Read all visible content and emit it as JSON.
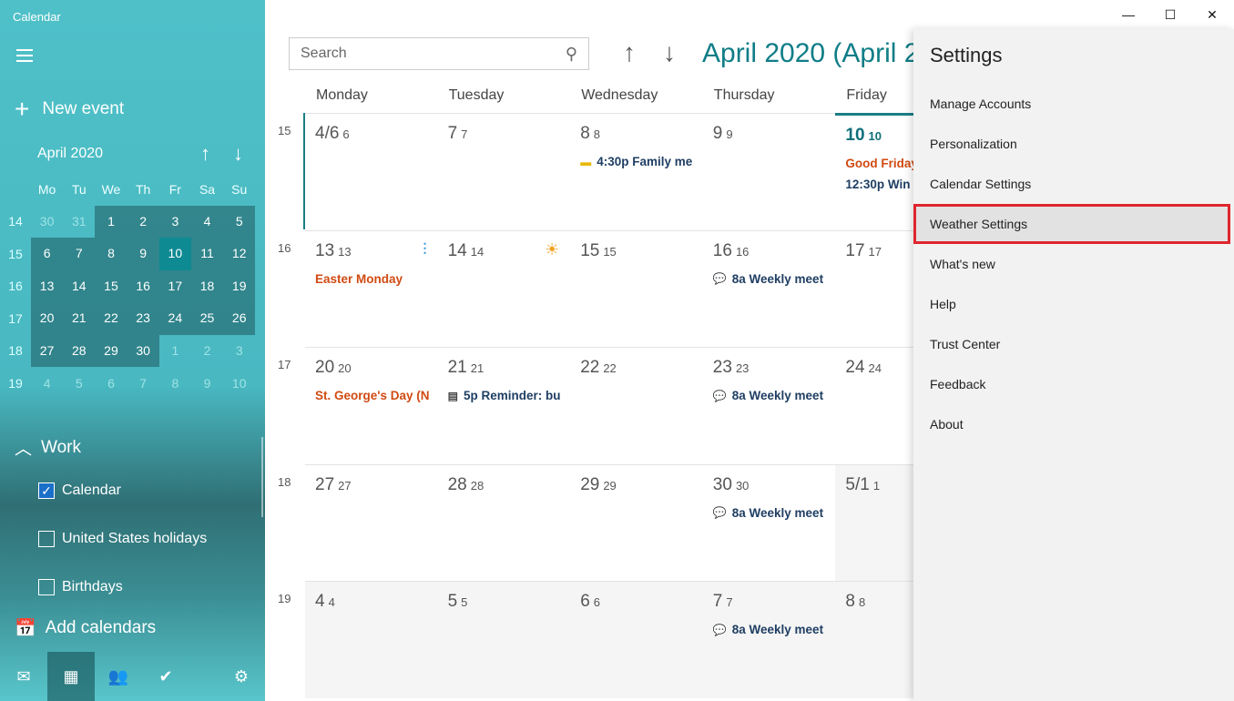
{
  "app": {
    "title": "Calendar"
  },
  "sidebar": {
    "new_event": "New event",
    "mini": {
      "month": "April 2020",
      "days": [
        "Mo",
        "Tu",
        "We",
        "Th",
        "Fr",
        "Sa",
        "Su"
      ],
      "weeks": [
        {
          "wk": "14",
          "d": [
            "30",
            "31",
            "1",
            "2",
            "3",
            "4",
            "5"
          ]
        },
        {
          "wk": "15",
          "d": [
            "6",
            "7",
            "8",
            "9",
            "10",
            "11",
            "12"
          ]
        },
        {
          "wk": "16",
          "d": [
            "13",
            "14",
            "15",
            "16",
            "17",
            "18",
            "19"
          ]
        },
        {
          "wk": "17",
          "d": [
            "20",
            "21",
            "22",
            "23",
            "24",
            "25",
            "26"
          ]
        },
        {
          "wk": "18",
          "d": [
            "27",
            "28",
            "29",
            "30",
            "1",
            "2",
            "3"
          ]
        },
        {
          "wk": "19",
          "d": [
            "4",
            "5",
            "6",
            "7",
            "8",
            "9",
            "10"
          ]
        }
      ]
    },
    "group": "Work",
    "calendars": [
      {
        "label": "Calendar",
        "checked": true
      },
      {
        "label": "United States holidays",
        "checked": false
      },
      {
        "label": "Birthdays",
        "checked": false
      }
    ],
    "add_calendars": "Add calendars",
    "nav": [
      "mail-icon",
      "calendar-icon",
      "people-icon",
      "todo-icon",
      "settings-icon"
    ]
  },
  "search": {
    "placeholder": "Search"
  },
  "header": {
    "title": "April 2020 (April 2"
  },
  "days": [
    "Monday",
    "Tuesday",
    "Wednesday",
    "Thursday",
    "Friday"
  ],
  "weeks": [
    {
      "wk": "15",
      "cells": [
        {
          "d": "4/6",
          "s": "6"
        },
        {
          "d": "7",
          "s": "7"
        },
        {
          "d": "8",
          "s": "8",
          "ev": [
            {
              "t": "4:30p Family me",
              "icon": "ticket-icon"
            }
          ]
        },
        {
          "d": "9",
          "s": "9"
        },
        {
          "d": "10",
          "s": "10",
          "today": true,
          "wx": "partly-sunny-icon",
          "ev": [
            {
              "t": "Good Friday",
              "hol": true
            },
            {
              "t": "12:30p  Win"
            }
          ]
        }
      ]
    },
    {
      "wk": "16",
      "cells": [
        {
          "d": "13",
          "s": "13",
          "wx": "rain-icon",
          "ev": [
            {
              "t": "Easter Monday",
              "hol": true
            }
          ]
        },
        {
          "d": "14",
          "s": "14",
          "wx": "sun-icon"
        },
        {
          "d": "15",
          "s": "15"
        },
        {
          "d": "16",
          "s": "16",
          "ev": [
            {
              "t": "8a Weekly meet",
              "icon": "chat-icon"
            }
          ]
        },
        {
          "d": "17",
          "s": "17"
        }
      ]
    },
    {
      "wk": "17",
      "cells": [
        {
          "d": "20",
          "s": "20",
          "ev": [
            {
              "t": "St. George's Day (N",
              "hol": true
            }
          ]
        },
        {
          "d": "21",
          "s": "21",
          "ev": [
            {
              "t": "5p Reminder: bu",
              "icon": "note-icon"
            }
          ]
        },
        {
          "d": "22",
          "s": "22"
        },
        {
          "d": "23",
          "s": "23",
          "ev": [
            {
              "t": "8a Weekly meet",
              "icon": "chat-icon"
            }
          ]
        },
        {
          "d": "24",
          "s": "24"
        }
      ]
    },
    {
      "wk": "18",
      "cells": [
        {
          "d": "27",
          "s": "27"
        },
        {
          "d": "28",
          "s": "28"
        },
        {
          "d": "29",
          "s": "29"
        },
        {
          "d": "30",
          "s": "30",
          "ev": [
            {
              "t": "8a Weekly meet",
              "icon": "chat-icon"
            }
          ]
        },
        {
          "d": "5/1",
          "s": "1",
          "gray": true
        }
      ]
    },
    {
      "wk": "19",
      "cells": [
        {
          "d": "4",
          "s": "4",
          "gray": true
        },
        {
          "d": "5",
          "s": "5",
          "gray": true
        },
        {
          "d": "6",
          "s": "6",
          "gray": true
        },
        {
          "d": "7",
          "s": "7",
          "gray": true,
          "ev": [
            {
              "t": "8a Weekly meet",
              "icon": "chat-icon"
            }
          ]
        },
        {
          "d": "8",
          "s": "8",
          "gray": true
        }
      ]
    }
  ],
  "settings": {
    "title": "Settings",
    "items": [
      "Manage Accounts",
      "Personalization",
      "Calendar Settings",
      "Weather Settings",
      "What's new",
      "Help",
      "Trust Center",
      "Feedback",
      "About"
    ],
    "selected": "Weather Settings",
    "highlight_color": "#e0262d"
  }
}
